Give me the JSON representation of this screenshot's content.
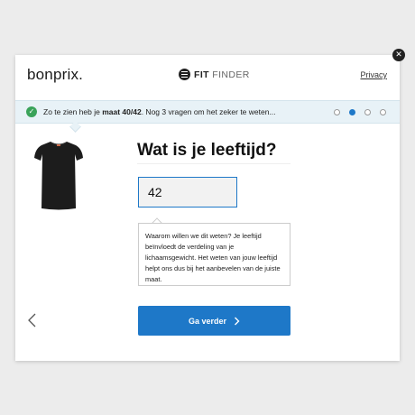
{
  "header": {
    "logo": "bonprix.",
    "app_name_bold": "FIT",
    "app_name_rest": " FINDER",
    "privacy_label": "Privacy"
  },
  "banner": {
    "text_prefix": "Zo te zien heb je ",
    "size_bold": "maat 40/42",
    "text_suffix": ". Nog 3 vragen om het zeker te weten...",
    "progress": {
      "total_steps": 4,
      "current_step": 2
    }
  },
  "product": {
    "image_alt": "black t-shirt",
    "color": "#1c1c1c"
  },
  "question": {
    "title": "Wat is je leeftijd?",
    "input_value": "42",
    "info_text": "Waarom willen we dit weten? Je leeftijd beïnvloedt de verdeling van je lichaamsgewicht. Het weten van jouw leeftijd helpt ons dus bij het aanbevelen van de juiste maat."
  },
  "actions": {
    "next_label": "Ga verder",
    "accent_color": "#1e78c8"
  },
  "icons": {
    "close": "close-icon",
    "check": "check-icon",
    "back": "chevron-left-icon",
    "next": "chevron-right-icon",
    "fitfinder": "fitfinder-logo-icon"
  }
}
